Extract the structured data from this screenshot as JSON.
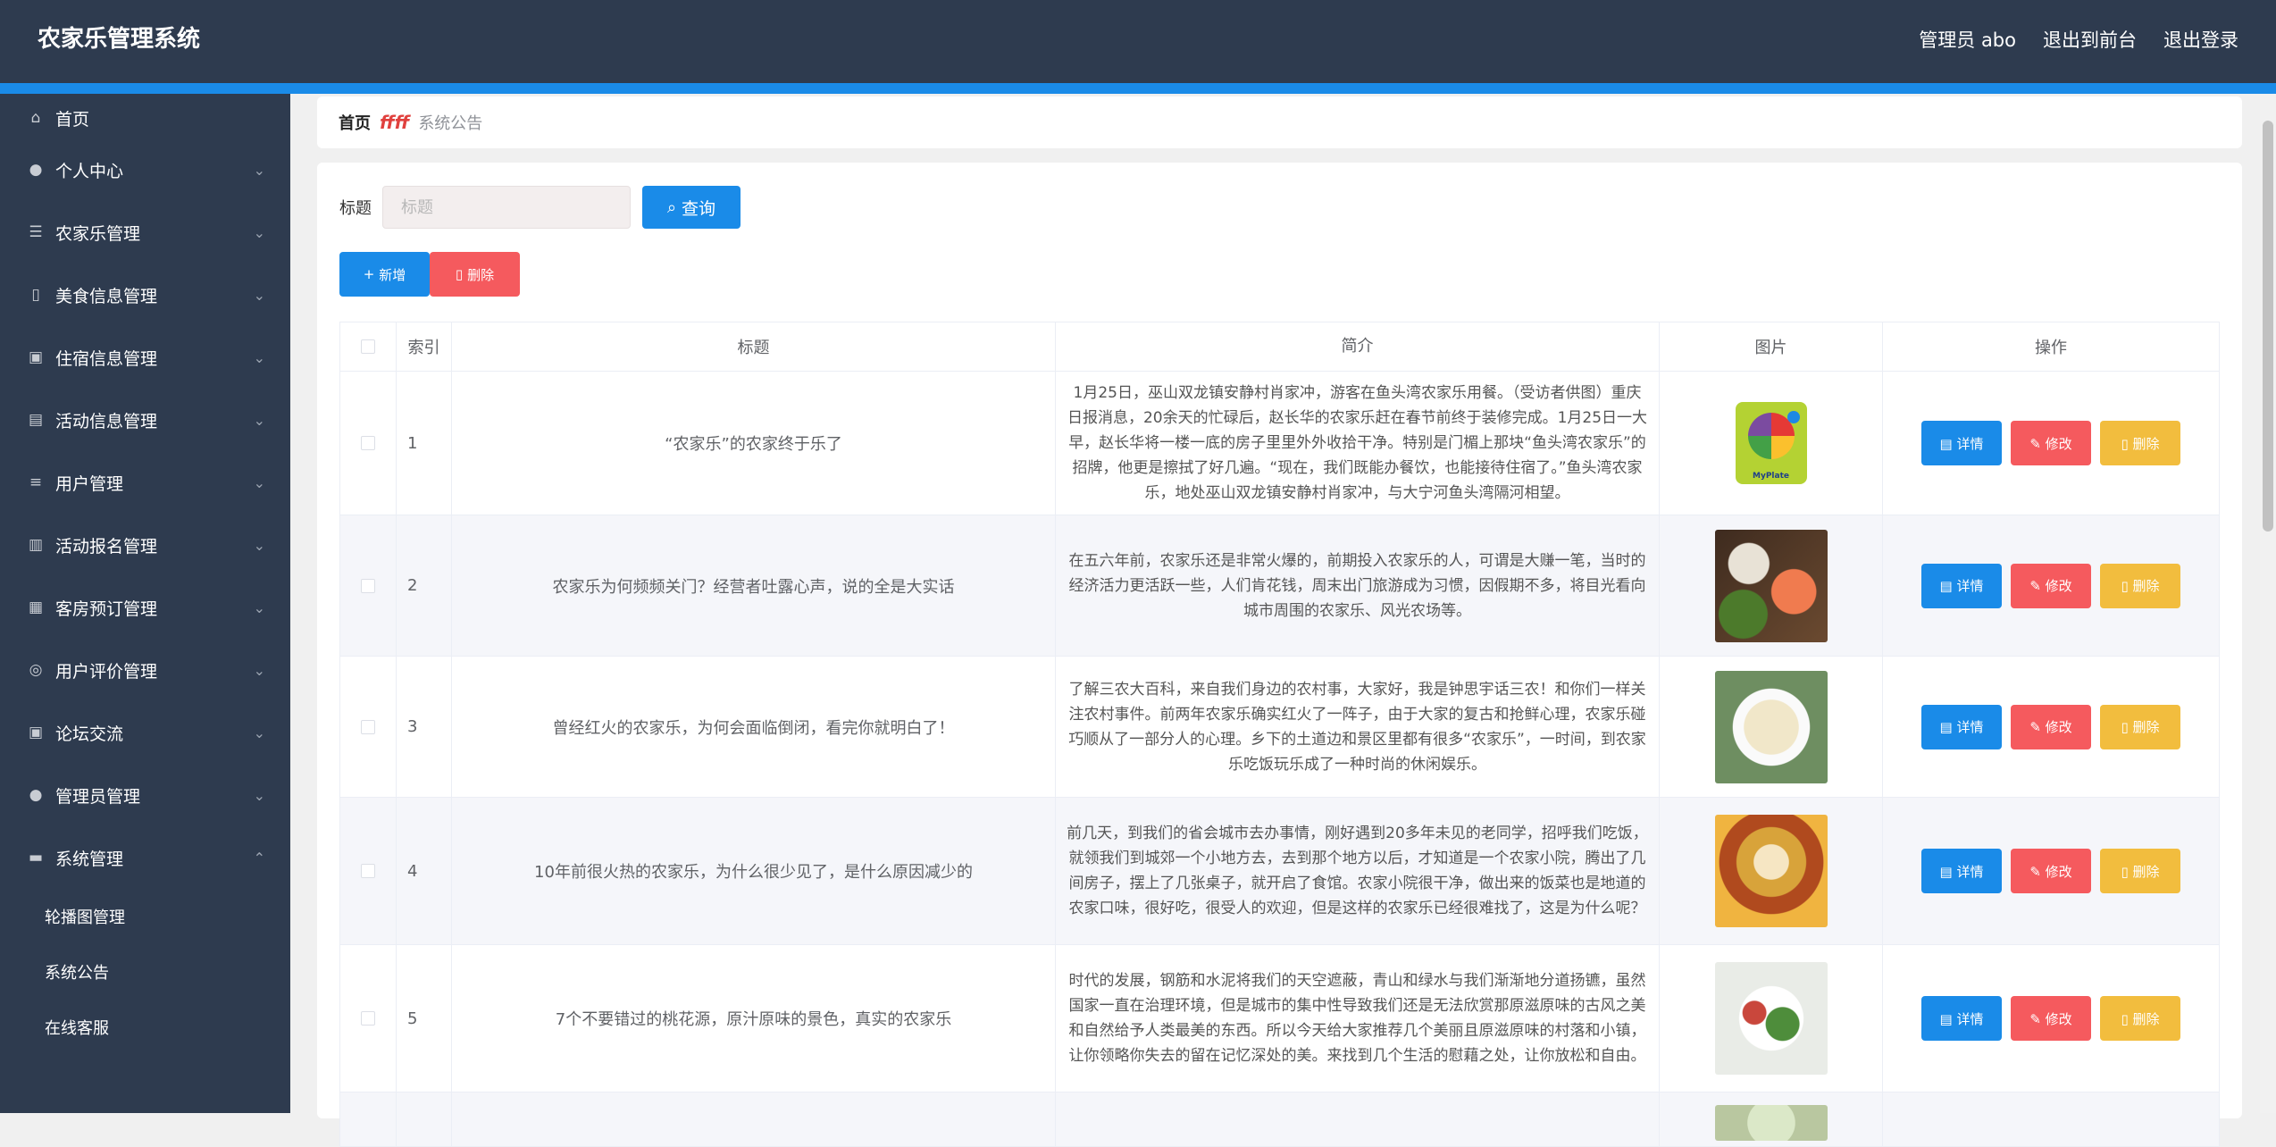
{
  "app": {
    "title": "农家乐管理系统"
  },
  "topbar": {
    "user": "管理员 abo",
    "to_front": "退出到前台",
    "logout": "退出登录"
  },
  "sidebar": {
    "items": [
      {
        "label": "首页",
        "icon": "home-icon"
      },
      {
        "label": "个人中心",
        "icon": "user-icon"
      },
      {
        "label": "农家乐管理",
        "icon": "list-icon"
      },
      {
        "label": "美食信息管理",
        "icon": "phone-icon"
      },
      {
        "label": "住宿信息管理",
        "icon": "clipboard-icon"
      },
      {
        "label": "活动信息管理",
        "icon": "briefcase-icon"
      },
      {
        "label": "用户管理",
        "icon": "sliders-icon"
      },
      {
        "label": "活动报名管理",
        "icon": "bank-icon"
      },
      {
        "label": "客房预订管理",
        "icon": "document-icon"
      },
      {
        "label": "用户评价管理",
        "icon": "circle-icon"
      },
      {
        "label": "论坛交流",
        "icon": "clipboard-icon"
      },
      {
        "label": "管理员管理",
        "icon": "user-icon"
      },
      {
        "label": "系统管理",
        "icon": "chat-icon"
      }
    ],
    "sub_items": [
      "轮播图管理",
      "系统公告",
      "在线客服"
    ]
  },
  "breadcrumb": {
    "home": "首页",
    "separator": "ffff",
    "current": "系统公告"
  },
  "search": {
    "label": "标题",
    "placeholder": "标题",
    "query_label": "查询"
  },
  "actions": {
    "add_label": "新增",
    "delete_label": "删除"
  },
  "table": {
    "headers": {
      "index": "索引",
      "title": "标题",
      "intro": "简介",
      "image": "图片",
      "ops": "操作"
    },
    "op_labels": {
      "detail": "详情",
      "edit": "修改",
      "delete": "删除"
    },
    "rows": [
      {
        "index": "1",
        "title": "“农家乐”的农家终于乐了",
        "intro": "1月25日，巫山双龙镇安静村肖家冲，游客在鱼头湾农家乐用餐。（受访者供图）重庆日报消息，20余天的忙碌后，赵长华的农家乐赶在春节前终于装修完成。1月25日一大早，赵长华将一楼一底的房子里里外外收拾干净。特别是门楣上那块“鱼头湾农家乐”的招牌，他更是擦拭了好几遍。“现在，我们既能办餐饮，也能接待住宿了。”鱼头湾农家乐，地处巫山双龙镇安静村肖家冲，与大宁河鱼头湾隔河相望。",
        "image_text": "MyPlate"
      },
      {
        "index": "2",
        "title": "农家乐为何频频关门？经营者吐露心声，说的全是大实话",
        "intro": "在五六年前，农家乐还是非常火爆的，前期投入农家乐的人，可谓是大赚一笔，当时的经济活力更活跃一些，人们肯花钱，周末出门旅游成为习惯，因假期不多，将目光看向城市周围的农家乐、风光农场等。"
      },
      {
        "index": "3",
        "title": "曾经红火的农家乐，为何会面临倒闭，看完你就明白了！",
        "intro": "了解三农大百科，来自我们身边的农村事，大家好，我是钟思宇话三农！和你们一样关注农村事件。前两年农家乐确实红火了一阵子，由于大家的复古和抢鲜心理，农家乐碰巧顺从了一部分人的心理。乡下的土道边和景区里都有很多“农家乐”，一时间，到农家乐吃饭玩乐成了一种时尚的休闲娱乐。"
      },
      {
        "index": "4",
        "title": "10年前很火热的农家乐，为什么很少见了，是什么原因减少的",
        "intro": "前几天，到我们的省会城市去办事情，刚好遇到20多年未见的老同学，招呼我们吃饭，就领我们到城郊一个小地方去，去到那个地方以后，才知道是一个农家小院，腾出了几间房子，摆上了几张桌子，就开启了食馆。农家小院很干净，做出来的饭菜也是地道的农家口味，很好吃，很受人的欢迎，但是这样的农家乐已经很难找了，这是为什么呢？"
      },
      {
        "index": "5",
        "title": "7个不要错过的桃花源，原汁原味的景色，真实的农家乐",
        "intro": "时代的发展，钢筋和水泥将我们的天空遮蔽，青山和绿水与我们渐渐地分道扬镳，虽然国家一直在治理环境，但是城市的集中性导致我们还是无法欣赏那原滋原味的古风之美和自然给予人类最美的东西。所以今天给大家推荐几个美丽且原滋原味的村落和小镇，让你领略你失去的留在记忆深处的美。来找到几个生活的慰藉之处，让你放松和自由。"
      }
    ]
  },
  "colors": {
    "topbar": "#2e3b4f",
    "accent": "#1a8be8",
    "danger": "#f55a5e",
    "warning": "#f2bd3e"
  }
}
